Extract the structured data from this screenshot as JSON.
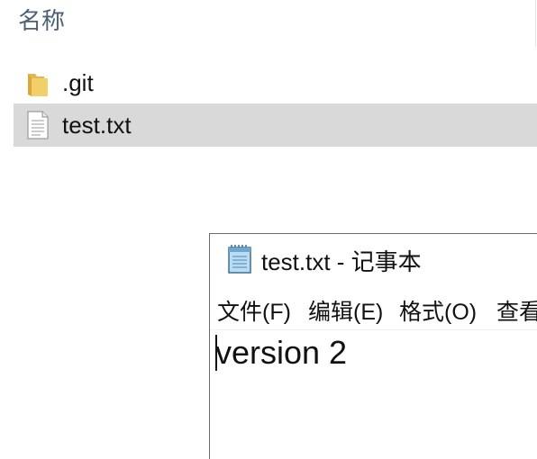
{
  "explorer": {
    "column_header": "名称",
    "files": [
      {
        "name": ".git",
        "icon": "folder-icon",
        "selected": false
      },
      {
        "name": "test.txt",
        "icon": "text-file-icon",
        "selected": true
      }
    ]
  },
  "notepad": {
    "title": "test.txt - 记事本",
    "menu": [
      "文件(F)",
      "编辑(E)",
      "格式(O)",
      "查看"
    ],
    "content": "version 2"
  },
  "colors": {
    "selection": "#d9d9d9",
    "header_text": "#4c607a",
    "folder": "#f3cf6b"
  }
}
